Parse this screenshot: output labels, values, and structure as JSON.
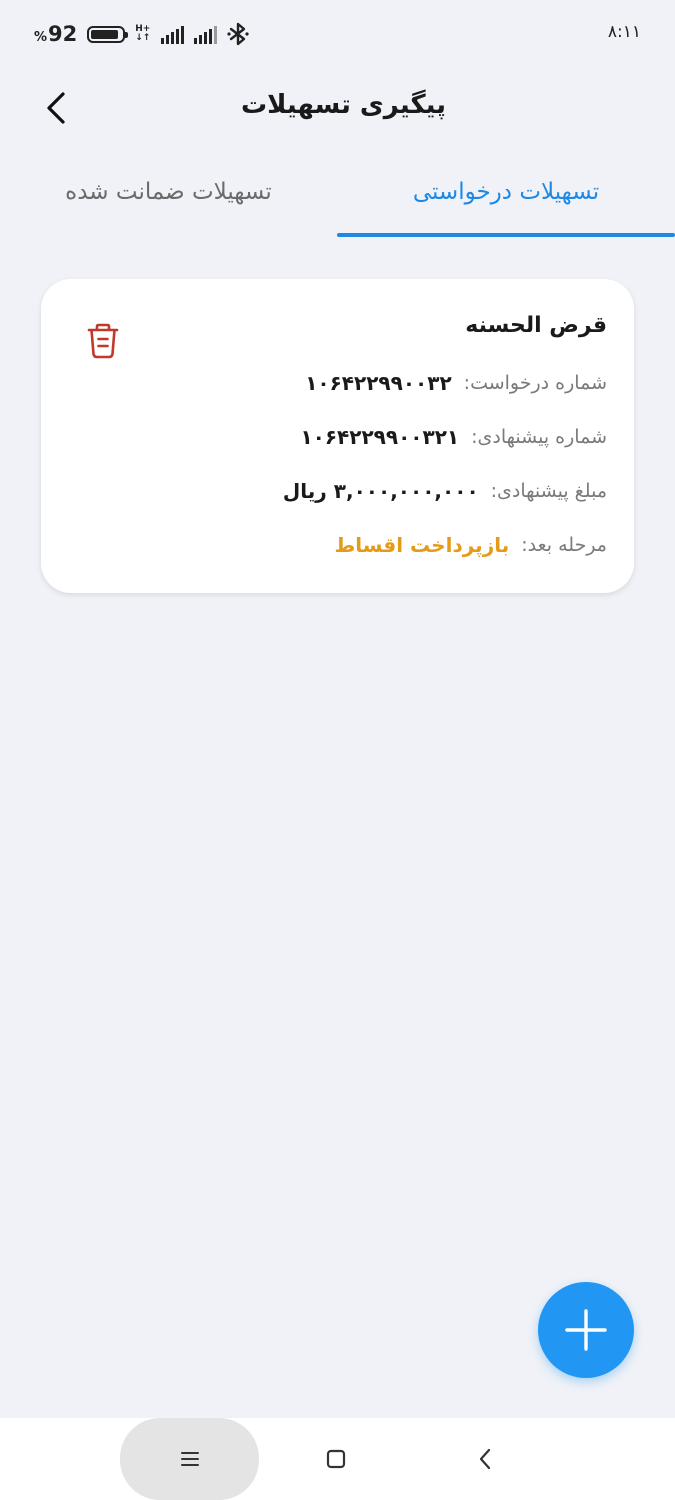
{
  "status_bar": {
    "battery_percent_sign": "%",
    "battery_level": "92",
    "network_type_top": "H+",
    "network_type_bottom": "↓↑",
    "time": "۸:۱۱"
  },
  "header": {
    "title": "پیگیری تسهیلات"
  },
  "tabs": [
    {
      "label": "تسهیلات درخواستی",
      "active": true
    },
    {
      "label": "تسهیلات ضمانت شده",
      "active": false
    }
  ],
  "loan_card": {
    "title": "قرض الحسنه",
    "request_number_label": "شماره درخواست:",
    "request_number": "۱۰۶۴۲۲۹۹۰۰۳۲",
    "proposal_number_label": "شماره پیشنهادی:",
    "proposal_number": "۱۰۶۴۲۲۹۹۰۰۳۲۱",
    "proposed_amount_label": "مبلغ پیشنهادی:",
    "proposed_amount": "۳,۰۰۰,۰۰۰,۰۰۰ ریال",
    "next_step_label": "مرحله بعد:",
    "next_step": "بازپرداخت اقساط"
  },
  "colors": {
    "accent_blue": "#1e88e5",
    "fab_blue": "#2196f3",
    "next_step_orange": "#e59b1a",
    "delete_red": "#c0392b",
    "background": "#f0f2f7"
  },
  "icons": {
    "back": "chevron-left-icon",
    "delete": "trash-icon",
    "fab": "plus-icon",
    "nav_menu": "menu-icon",
    "nav_home": "square-icon",
    "nav_back": "chevron-left-icon"
  }
}
